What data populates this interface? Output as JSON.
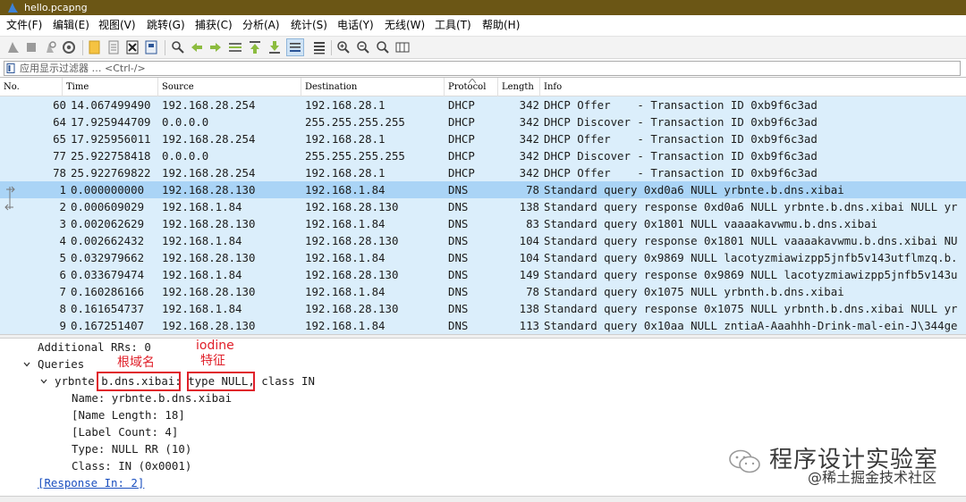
{
  "window": {
    "title": "hello.pcapng"
  },
  "menu": [
    {
      "label": "文件(F)",
      "name": "menu-file"
    },
    {
      "label": "编辑(E)",
      "name": "menu-edit"
    },
    {
      "label": "视图(V)",
      "name": "menu-view"
    },
    {
      "label": "跳转(G)",
      "name": "menu-go"
    },
    {
      "label": "捕获(C)",
      "name": "menu-capture"
    },
    {
      "label": "分析(A)",
      "name": "menu-analyze"
    },
    {
      "label": "统计(S)",
      "name": "menu-statistics"
    },
    {
      "label": "电话(Y)",
      "name": "menu-telephony"
    },
    {
      "label": "无线(W)",
      "name": "menu-wireless"
    },
    {
      "label": "工具(T)",
      "name": "menu-tools"
    },
    {
      "label": "帮助(H)",
      "name": "menu-help"
    }
  ],
  "toolbar": {
    "icons": [
      "shark-fin-start-icon",
      "stop-square-icon",
      "restart-icon",
      "capture-options-gear-icon",
      "open-folder-icon",
      "file-set-icon",
      "close-file-icon",
      "reload-icon",
      "find-packet-icon",
      "go-back-icon",
      "go-forward-icon",
      "go-to-packet-icon",
      "go-first-icon",
      "go-last-icon",
      "auto-scroll-icon",
      "colorize-icon",
      "zoom-in-icon",
      "zoom-out-icon",
      "zoom-normal-icon",
      "resize-columns-icon"
    ]
  },
  "filter": {
    "placeholder": "应用显示过滤器 … <Ctrl-/>"
  },
  "columns": {
    "no": "No.",
    "time": "Time",
    "source": "Source",
    "destination": "Destination",
    "protocol": "Protocol",
    "length": "Length",
    "info": "Info"
  },
  "packets": [
    {
      "no": "60",
      "time": "14.067499490",
      "src": "192.168.28.254",
      "dst": "192.168.28.1",
      "proto": "DHCP",
      "len": "342",
      "info": "DHCP Offer    - Transaction ID 0xb9f6c3ad"
    },
    {
      "no": "64",
      "time": "17.925944709",
      "src": "0.0.0.0",
      "dst": "255.255.255.255",
      "proto": "DHCP",
      "len": "342",
      "info": "DHCP Discover - Transaction ID 0xb9f6c3ad"
    },
    {
      "no": "65",
      "time": "17.925956011",
      "src": "192.168.28.254",
      "dst": "192.168.28.1",
      "proto": "DHCP",
      "len": "342",
      "info": "DHCP Offer    - Transaction ID 0xb9f6c3ad"
    },
    {
      "no": "77",
      "time": "25.922758418",
      "src": "0.0.0.0",
      "dst": "255.255.255.255",
      "proto": "DHCP",
      "len": "342",
      "info": "DHCP Discover - Transaction ID 0xb9f6c3ad"
    },
    {
      "no": "78",
      "time": "25.922769822",
      "src": "192.168.28.254",
      "dst": "192.168.28.1",
      "proto": "DHCP",
      "len": "342",
      "info": "DHCP Offer    - Transaction ID 0xb9f6c3ad"
    },
    {
      "no": "1",
      "time": "0.000000000",
      "src": "192.168.28.130",
      "dst": "192.168.1.84",
      "proto": "DNS",
      "len": "78",
      "info": "Standard query 0xd0a6 NULL yrbnte.b.dns.xibai",
      "selected": true,
      "related": "request"
    },
    {
      "no": "2",
      "time": "0.000609029",
      "src": "192.168.1.84",
      "dst": "192.168.28.130",
      "proto": "DNS",
      "len": "138",
      "info": "Standard query response 0xd0a6 NULL yrbnte.b.dns.xibai NULL yr",
      "related": "response"
    },
    {
      "no": "3",
      "time": "0.002062629",
      "src": "192.168.28.130",
      "dst": "192.168.1.84",
      "proto": "DNS",
      "len": "83",
      "info": "Standard query 0x1801 NULL vaaaakavwmu.b.dns.xibai"
    },
    {
      "no": "4",
      "time": "0.002662432",
      "src": "192.168.1.84",
      "dst": "192.168.28.130",
      "proto": "DNS",
      "len": "104",
      "info": "Standard query response 0x1801 NULL vaaaakavwmu.b.dns.xibai NU"
    },
    {
      "no": "5",
      "time": "0.032979662",
      "src": "192.168.28.130",
      "dst": "192.168.1.84",
      "proto": "DNS",
      "len": "104",
      "info": "Standard query 0x9869 NULL lacotyzmiawizpp5jnfb5v143utflmzq.b."
    },
    {
      "no": "6",
      "time": "0.033679474",
      "src": "192.168.1.84",
      "dst": "192.168.28.130",
      "proto": "DNS",
      "len": "149",
      "info": "Standard query response 0x9869 NULL lacotyzmiawizpp5jnfb5v143u"
    },
    {
      "no": "7",
      "time": "0.160286166",
      "src": "192.168.28.130",
      "dst": "192.168.1.84",
      "proto": "DNS",
      "len": "78",
      "info": "Standard query 0x1075 NULL yrbnth.b.dns.xibai"
    },
    {
      "no": "8",
      "time": "0.161654737",
      "src": "192.168.1.84",
      "dst": "192.168.28.130",
      "proto": "DNS",
      "len": "138",
      "info": "Standard query response 0x1075 NULL yrbnth.b.dns.xibai NULL yr"
    },
    {
      "no": "9",
      "time": "0.167251407",
      "src": "192.168.28.130",
      "dst": "192.168.1.84",
      "proto": "DNS",
      "len": "113",
      "info": "Standard query 0x10aa NULL zntiaA-Aaahhh-Drink-mal-ein-J\\344ge"
    }
  ],
  "details": {
    "additional_rrs": "Additional RRs: 0",
    "queries": "Queries",
    "query_name_prefix": "yrbnte ",
    "query_domain": "b.dns.xibai",
    "query_colon": ":",
    "query_type": "type NULL",
    "query_class": ", class IN",
    "name": "Name: yrbnte.b.dns.xibai",
    "name_length": "[Name Length: 18]",
    "label_count": "[Label Count: 4]",
    "type": "Type: NULL RR (10)",
    "class": "Class: IN (0x0001)",
    "response_in": "[Response In: 2]"
  },
  "annotations": {
    "root_domain": "根域名",
    "iodine_line1": "iodine",
    "iodine_line2": "特征"
  },
  "watermark": {
    "title": "程序设计实验室",
    "subtitle": "@稀土掘金技术社区"
  },
  "colors": {
    "title_bar": "#6b5615",
    "row_bg": "#dbeefb",
    "row_selected": "#aad4f6",
    "annotation_red": "#e0202a",
    "link_blue": "#1a4fbf"
  }
}
